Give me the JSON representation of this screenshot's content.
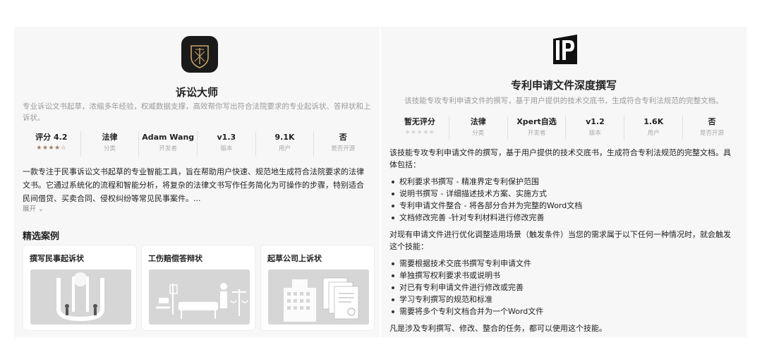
{
  "left": {
    "title": "诉讼大师",
    "description": "专业诉讼文书起草，浓缩多年经验，权威数据支撑，高效帮你写出符合法院要求的专业起诉状、答辩状和上诉状。",
    "stats": [
      {
        "value": "评分 4.2",
        "label": "",
        "rating": 4.2
      },
      {
        "value": "法律",
        "label": "分类"
      },
      {
        "value": "Adam Wang",
        "label": "开发者"
      },
      {
        "value": "v1.3",
        "label": "版本"
      },
      {
        "value": "9.1K",
        "label": "用户"
      },
      {
        "value": "否",
        "label": "是否开源"
      }
    ],
    "body": "一款专注于民事诉讼文书起草的专业智能工具，旨在帮助用户快速、规范地生成符合法院要求的法律文书。它通过系统化的流程和智能分析，将复杂的法律文书写作任务简化为可操作的步骤，特别适合民间借贷、买卖合同、侵权纠纷等常见民事案件。...",
    "expand_label": "展开",
    "cases_title": "精选案例",
    "cases": [
      {
        "title": "撰写民事起诉状",
        "icon": "court-scene-icon"
      },
      {
        "title": "工伤赔偿答辩状",
        "icon": "hospital-scene-icon"
      },
      {
        "title": "起草公司上诉状",
        "icon": "building-documents-icon"
      }
    ]
  },
  "right": {
    "title": "专利申请文件深度撰写",
    "description": "该技能专攻专利申请文件的撰写，基于用户提供的技术交底书，生成符合专利法规范的完整文档。",
    "stats": [
      {
        "value": "暂无评分",
        "label": "",
        "rating": 0
      },
      {
        "value": "法律",
        "label": "分类"
      },
      {
        "value": "Xpert自选",
        "label": "开发者"
      },
      {
        "value": "v1.2",
        "label": "版本"
      },
      {
        "value": "1.6K",
        "label": "用户"
      },
      {
        "value": "否",
        "label": "是否开源"
      }
    ],
    "intro": "该技能专攻专利申请文件的撰写，基于用户提供的技术交底书，生成符合专利法规范的完整文档。具体包括：",
    "features": [
      "权利要求书撰写 - 精准界定专利保护范围",
      "说明书撰写 - 详细描述技术方案、实施方式",
      "专利申请文件整合 - 将各部分合并为完整的Word文档",
      "文档修改完善 -针对专利材料进行修改完善"
    ],
    "trigger_intro": "对现有申请文件进行优化调整适用场景（触发条件）当您的需求属于以下任何一种情况时，就会触发这个技能：",
    "triggers": [
      "需要根据技术交底书撰写专利申请文件",
      "单独撰写权利要求书或说明书",
      "对已有专利申请文件进行修改或完善",
      "学习专利撰写的规范和标准",
      "需要将多个专利文档合并为一个Word文件"
    ],
    "closing": "凡是涉及专利撰写、修改、整合的任务，都可以使用这个技能。"
  },
  "colors": {
    "panel_bg": "#f7f7f8",
    "star_filled": "#a07e5c",
    "star_empty": "#d4d4d4",
    "logo_gold": "#c9a36a"
  }
}
